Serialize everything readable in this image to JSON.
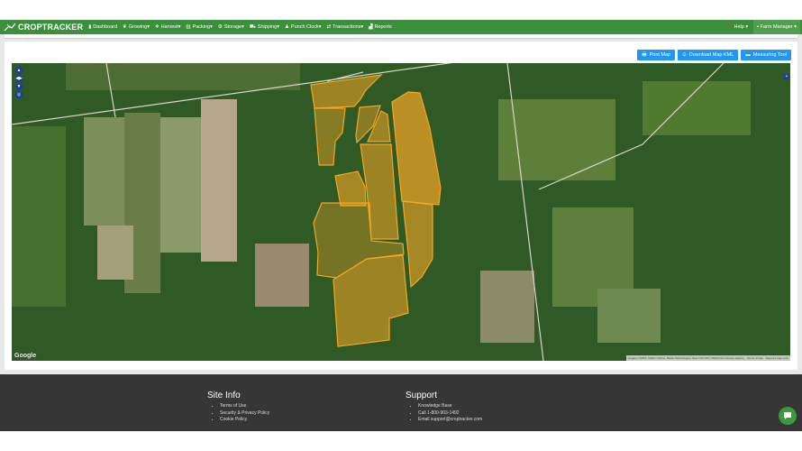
{
  "brand": "CROPTRACKER",
  "nav": [
    {
      "label": "Dashboard",
      "icon": "dashboard-icon",
      "dropdown": false
    },
    {
      "label": "Growing",
      "icon": "leaf-icon",
      "dropdown": true
    },
    {
      "label": "Harvest",
      "icon": "harvest-icon",
      "dropdown": true
    },
    {
      "label": "Packing",
      "icon": "packing-icon",
      "dropdown": true
    },
    {
      "label": "Storage",
      "icon": "storage-icon",
      "dropdown": true
    },
    {
      "label": "Shipping",
      "icon": "truck-icon",
      "dropdown": true
    },
    {
      "label": "Punch Clock",
      "icon": "user-icon",
      "dropdown": true
    },
    {
      "label": "Transactions",
      "icon": "exchange-icon",
      "dropdown": true
    },
    {
      "label": "Reports",
      "icon": "chart-icon",
      "dropdown": false
    }
  ],
  "help": "Help",
  "user": "Farm Manager",
  "toolbar": {
    "print": "Print Map",
    "download": "Download Map KML",
    "measure": "Measuring Tool"
  },
  "map": {
    "google": "Google",
    "attribution": "Imagery ©2019, CNES / Airbus, Maxar Technologies, New York GIS, USDA Farm Service Agency",
    "terms": "Terms of Use",
    "report": "Report a map error",
    "field_color": "#f5a623"
  },
  "footer": {
    "site_info": {
      "title": "Site Info",
      "items": [
        "Terms of Use",
        "Security & Privacy Policy",
        "Cookie Policy"
      ]
    },
    "support": {
      "title": "Support",
      "items": [
        "Knowledge Base",
        "Call 1-800-903-1492",
        "Email support@croptracker.com"
      ]
    }
  }
}
